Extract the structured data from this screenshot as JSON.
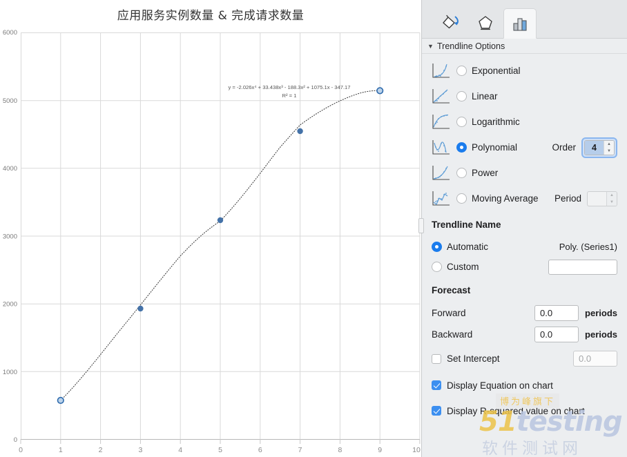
{
  "chart_data": {
    "type": "scatter",
    "title": "应用服务实例数量 & 完成请求数量",
    "xlabel": "",
    "ylabel": "",
    "x": [
      1,
      3,
      5,
      7,
      9
    ],
    "values": [
      570,
      1930,
      3230,
      4550,
      5150
    ],
    "series": [
      {
        "name": "Series1",
        "values": [
          570,
          1930,
          3230,
          4550,
          5150
        ]
      }
    ],
    "xlim": [
      0,
      10
    ],
    "ylim": [
      0,
      6000
    ],
    "xticks": [
      "0",
      "1",
      "2",
      "3",
      "4",
      "5",
      "6",
      "7",
      "8",
      "9",
      "10"
    ],
    "yticks": [
      "0",
      "1000",
      "2000",
      "3000",
      "4000",
      "5000",
      "6000"
    ],
    "grid": true,
    "legend": "none",
    "trendline": {
      "kind": "polynomial",
      "order": 4,
      "equation": "y = -2.026x⁴ + 33.438x³ - 188.3x² + 1075.1x - 347.17",
      "r_squared": "R² = 1",
      "style": "dotted"
    },
    "marker_color": "#4472a8",
    "accent_color": "#1a7ced"
  },
  "panel": {
    "tabs": [
      {
        "id": "fill-line",
        "icon": "paint-bucket-icon",
        "active": false
      },
      {
        "id": "effects",
        "icon": "pentagon-icon",
        "active": false
      },
      {
        "id": "chart-options",
        "icon": "bar-chart-icon",
        "active": true
      }
    ],
    "section_header": "Trendline Options",
    "disclosure_glyph": "▼",
    "trendline_options": [
      {
        "label": "Exponential",
        "selected": false
      },
      {
        "label": "Linear",
        "selected": false
      },
      {
        "label": "Logarithmic",
        "selected": false
      },
      {
        "label": "Polynomial",
        "selected": true
      },
      {
        "label": "Power",
        "selected": false
      },
      {
        "label": "Moving Average",
        "selected": false
      }
    ],
    "order": {
      "label": "Order",
      "value": "4",
      "focused": true
    },
    "period": {
      "label": "Period",
      "value": "",
      "disabled": true
    },
    "trendline_name": {
      "title": "Trendline Name",
      "automatic_label": "Automatic",
      "automatic_selected": true,
      "automatic_value": "Poly. (Series1)",
      "custom_label": "Custom",
      "custom_selected": false,
      "custom_value": ""
    },
    "forecast": {
      "title": "Forecast",
      "forward_label": "Forward",
      "forward_value": "0.0",
      "forward_unit": "periods",
      "backward_label": "Backward",
      "backward_value": "0.0",
      "backward_unit": "periods",
      "set_intercept_label": "Set Intercept",
      "set_intercept_checked": false,
      "set_intercept_value": "0.0"
    },
    "checkboxes": [
      {
        "label": "Display Equation on chart",
        "checked": true
      },
      {
        "label": "Display R-squared value on chart",
        "checked": true
      }
    ]
  },
  "watermark": {
    "top": "博为峰旗下",
    "main_a": "51",
    "main_b": "testing",
    "sub": "软件测试网"
  }
}
